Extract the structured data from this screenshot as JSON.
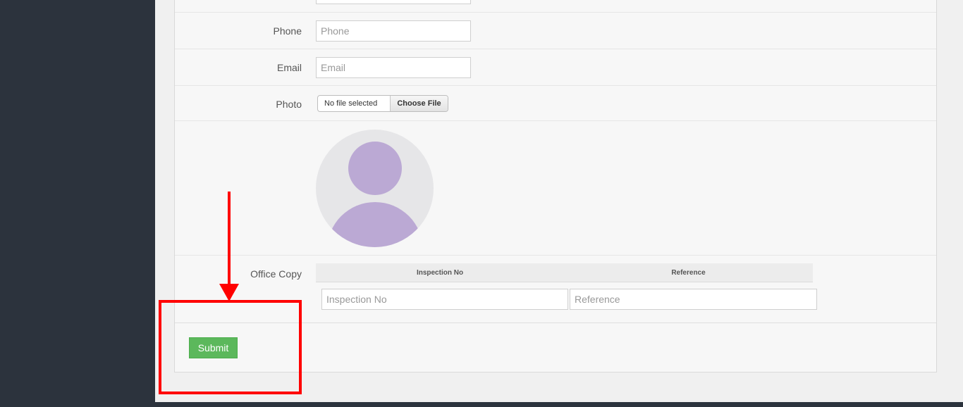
{
  "form": {
    "phone": {
      "label": "Phone",
      "placeholder": "Phone"
    },
    "email": {
      "label": "Email",
      "placeholder": "Email"
    },
    "photo": {
      "label": "Photo",
      "file_status": "No file selected",
      "choose_label": "Choose File"
    },
    "office_copy": {
      "label": "Office Copy",
      "columns": [
        "Inspection No",
        "Reference"
      ],
      "inspection_placeholder": "Inspection No",
      "reference_placeholder": "Reference"
    },
    "submit_label": "Submit"
  },
  "colors": {
    "sidebar": "#2c333d",
    "submit": "#5cb85c",
    "avatar_bg": "#e6e6e8",
    "avatar_figure": "#bba9d4",
    "annotation": "#ff0000"
  }
}
